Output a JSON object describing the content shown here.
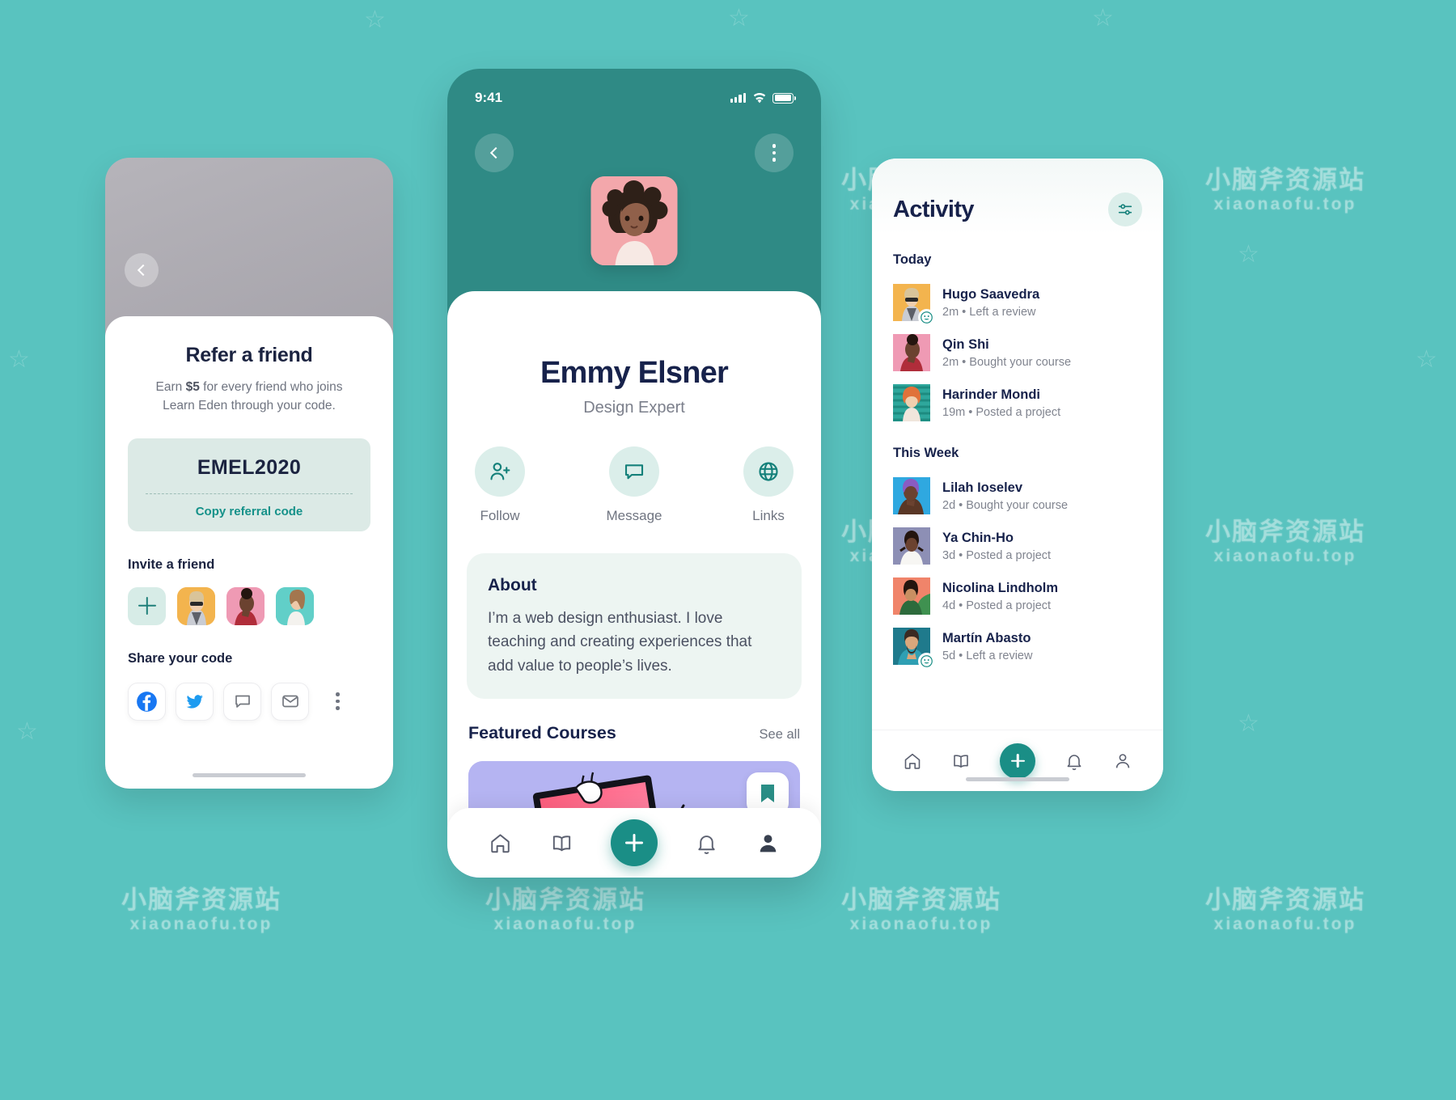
{
  "background": {
    "color": "#59c3bf"
  },
  "watermarks": [
    {
      "cn": "小脑斧资源站",
      "en": "xiaonaofu.top"
    }
  ],
  "refer_screen": {
    "name": "refer-a-friend-screen",
    "back_icon": "chevron-left-icon",
    "title": "Refer a friend",
    "subtitle_before": "Earn ",
    "subtitle_amount": "$5",
    "subtitle_after": " for every friend who joins",
    "subtitle_line2": "Learn Eden through your code.",
    "referral_code": "EMEL2020",
    "copy_action": "Copy referral code",
    "invite_heading": "Invite a friend",
    "invite_avatars": [
      {
        "name": "add-friend",
        "type": "add",
        "color": "#d7ece7"
      },
      {
        "name": "friend-1",
        "type": "photo",
        "color": "#f3b44e"
      },
      {
        "name": "friend-2",
        "type": "photo",
        "color": "#ef9ab4"
      },
      {
        "name": "friend-3",
        "type": "photo",
        "color": "#61cfc8"
      }
    ],
    "share_heading": "Share your code",
    "share_buttons": [
      {
        "name": "facebook-icon",
        "label": "Facebook",
        "color": "#1877f2"
      },
      {
        "name": "twitter-icon",
        "label": "Twitter",
        "color": "#1d9bf0"
      },
      {
        "name": "message-icon",
        "label": "Message",
        "color": "#6f7480"
      },
      {
        "name": "email-icon",
        "label": "Email",
        "color": "#6f7480"
      },
      {
        "name": "more-icon",
        "label": "More",
        "color": "#6f7480"
      }
    ]
  },
  "profile_screen": {
    "name": "profile-screen",
    "status_bar": {
      "time": "9:41",
      "signal_icon": "cellular-bars-icon",
      "wifi_icon": "wifi-icon",
      "battery_icon": "battery-full-icon"
    },
    "back_icon": "chevron-left-icon",
    "more_icon": "more-vertical-icon",
    "avatar_name": "profile-avatar",
    "user_name": "Emmy Elsner",
    "user_role": "Design Expert",
    "actions": [
      {
        "icon": "user-plus-icon",
        "label": "Follow"
      },
      {
        "icon": "message-bubble-icon",
        "label": "Message"
      },
      {
        "icon": "globe-icon",
        "label": "Links"
      }
    ],
    "about": {
      "title": "About",
      "body": "I’m a web design enthusiast. I love teaching and creating experiences that add value to people’s lives."
    },
    "featured": {
      "title": "Featured Courses",
      "see_all": "See all",
      "bookmark_icon": "bookmark-icon"
    },
    "tabbar": [
      {
        "icon": "home-icon",
        "name": "tab-home"
      },
      {
        "icon": "book-icon",
        "name": "tab-library"
      },
      {
        "icon": "plus-icon",
        "name": "tab-add"
      },
      {
        "icon": "bell-icon",
        "name": "tab-notifications"
      },
      {
        "icon": "person-icon",
        "name": "tab-profile"
      }
    ],
    "accent": "#1a8e86",
    "header_color": "#2f8a85"
  },
  "activity_screen": {
    "name": "activity-screen",
    "title": "Activity",
    "filter_icon": "sliders-icon",
    "groups": [
      {
        "label": "Today",
        "items": [
          {
            "name": "Hugo Saavedra",
            "meta": "2m • Left a review",
            "avatar_color": "#f3b44e",
            "badge": "smile-icon"
          },
          {
            "name": "Qin Shi",
            "meta": "2m • Bought your course",
            "avatar_color": "#ef9ab4",
            "badge": ""
          },
          {
            "name": "Harinder Mondi",
            "meta": "19m • Posted a project",
            "avatar_color": "#2ea79c",
            "badge": ""
          }
        ]
      },
      {
        "label": "This Week",
        "items": [
          {
            "name": "Lilah Ioselev",
            "meta": "2d • Bought your course",
            "avatar_color": "#2fa8e0",
            "badge": ""
          },
          {
            "name": "Ya Chin-Ho",
            "meta": "3d • Posted a project",
            "avatar_color": "#8d8fb5",
            "badge": ""
          },
          {
            "name": "Nicolina Lindholm",
            "meta": "4d • Posted a project",
            "avatar_color": "#f0846a",
            "badge": ""
          },
          {
            "name": "Martín Abasto",
            "meta": "5d • Left a review",
            "avatar_color": "#1f7a8c",
            "badge": "smile-icon"
          }
        ]
      }
    ],
    "tabbar": [
      {
        "icon": "home-icon",
        "name": "tab-home"
      },
      {
        "icon": "book-icon",
        "name": "tab-library"
      },
      {
        "icon": "plus-icon",
        "name": "tab-add"
      },
      {
        "icon": "bell-icon",
        "name": "tab-notifications"
      },
      {
        "icon": "person-icon",
        "name": "tab-profile"
      }
    ]
  }
}
